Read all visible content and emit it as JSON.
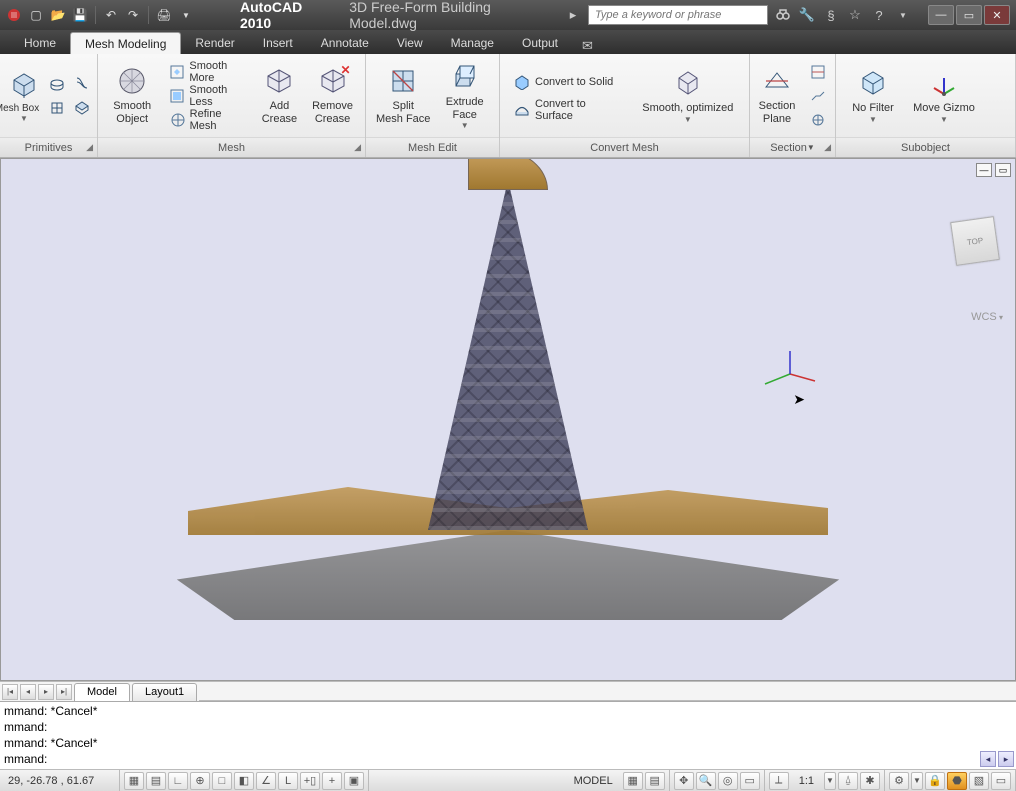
{
  "title": {
    "app": "AutoCAD 2010",
    "doc": "3D Free-Form Building Model.dwg"
  },
  "search": {
    "placeholder": "Type a keyword or phrase"
  },
  "tabs": {
    "items": [
      "Home",
      "Mesh Modeling",
      "Render",
      "Insert",
      "Annotate",
      "View",
      "Manage",
      "Output"
    ],
    "active_index": 1
  },
  "ribbon": {
    "primitives": {
      "title": "Primitives",
      "mesh_box": "Mesh Box"
    },
    "mesh": {
      "title": "Mesh",
      "smooth_object": "Smooth\nObject",
      "smooth_more": "Smooth More",
      "smooth_less": "Smooth Less",
      "refine_mesh": "Refine Mesh",
      "add_crease": "Add\nCrease",
      "remove_crease": "Remove\nCrease"
    },
    "mesh_edit": {
      "title": "Mesh Edit",
      "split_face": "Split\nMesh Face",
      "extrude_face": "Extrude\nFace"
    },
    "convert": {
      "title": "Convert Mesh",
      "to_solid": "Convert to Solid",
      "to_surface": "Convert to Surface",
      "smooth_opt": "Smooth, optimized"
    },
    "section": {
      "title": "Section",
      "section_plane": "Section\nPlane"
    },
    "subobject": {
      "title": "Subobject",
      "no_filter": "No Filter",
      "move_gizmo": "Move Gizmo"
    }
  },
  "viewport": {
    "wcs": "WCS",
    "cube_face": "TOP"
  },
  "model_tabs": {
    "items": [
      "Model",
      "Layout1"
    ],
    "active_index": 0
  },
  "cmd": {
    "lines": [
      "mmand: *Cancel*",
      "mmand:",
      "mmand: *Cancel*",
      "mmand:"
    ]
  },
  "status": {
    "coords": "29, -26.78 , 61.67",
    "model": "MODEL",
    "scale": "1:1"
  }
}
